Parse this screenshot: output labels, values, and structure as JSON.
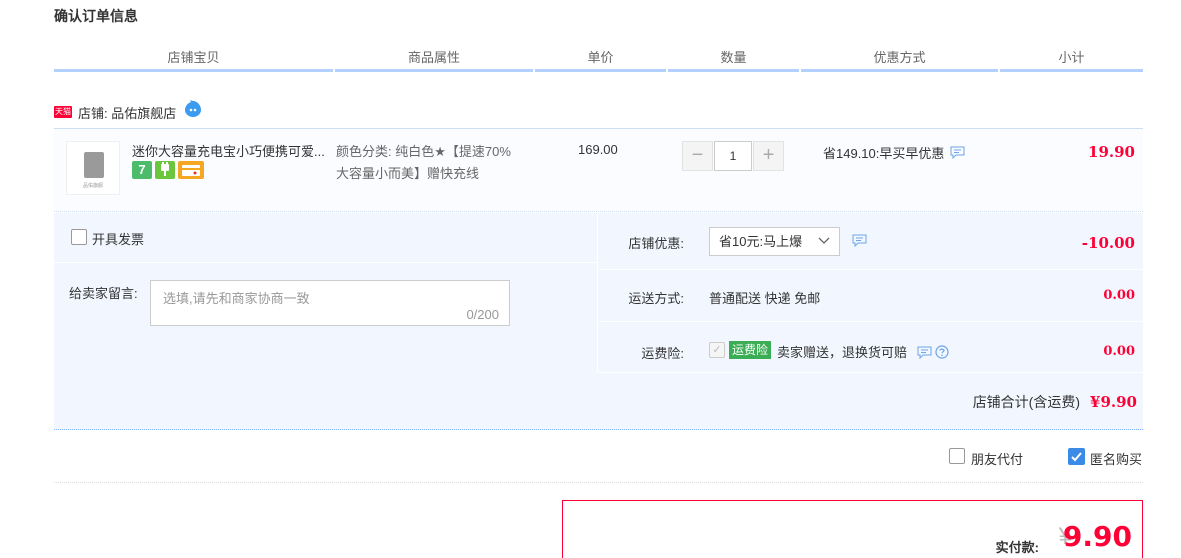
{
  "page": {
    "title": "确认订单信息"
  },
  "table_headers": [
    "店铺宝贝",
    "商品属性",
    "单价",
    "数量",
    "优惠方式",
    "小计"
  ],
  "shop": {
    "badge": "天猫",
    "label": "店铺: 品佑旗舰店"
  },
  "item": {
    "thumb_text": "品佑旗舰",
    "title": "迷你大容量充电宝小巧便携可爱...",
    "service_icons": [
      "7",
      "plug-icon",
      "card-icon"
    ],
    "attr_line1": "颜色分类: 纯白色★【提速70%",
    "attr_line2": "大容量小而美】赠快充线",
    "unit_price": "169.00",
    "qty_minus": "−",
    "qty_value": "1",
    "qty_plus": "+",
    "promo": "省149.10:早买早优惠",
    "subtotal": "19.90"
  },
  "invoice": {
    "label": "开具发票"
  },
  "message": {
    "label": "给卖家留言:",
    "placeholder": "选填,请先和商家协商一致",
    "counter": "0/200"
  },
  "coupon": {
    "label": "店铺优惠:",
    "selected": "省10元:马上爆",
    "amount": "-10.00"
  },
  "shipping": {
    "label": "运送方式:",
    "value": "普通配送 快递 免邮",
    "amount": "0.00"
  },
  "insurance": {
    "label": "运费险:",
    "badge": "运费险",
    "text": "卖家赠送，退换货可赔",
    "amount": "0.00"
  },
  "shop_total": {
    "label": "店铺合计(含运费)",
    "value": "¥9.90"
  },
  "options": {
    "friend_pay": "朋友代付",
    "anonymous": "匿名购买"
  },
  "payment": {
    "label": "实付款:",
    "currency": "¥",
    "value": "9.90"
  },
  "colors": {
    "accent": "#ff0036",
    "header_border": "#b2d1ff",
    "panel_bg": "#f2f7ff",
    "insurance_green": "#3bad55",
    "checkbox_blue": "#3b8ae6"
  }
}
